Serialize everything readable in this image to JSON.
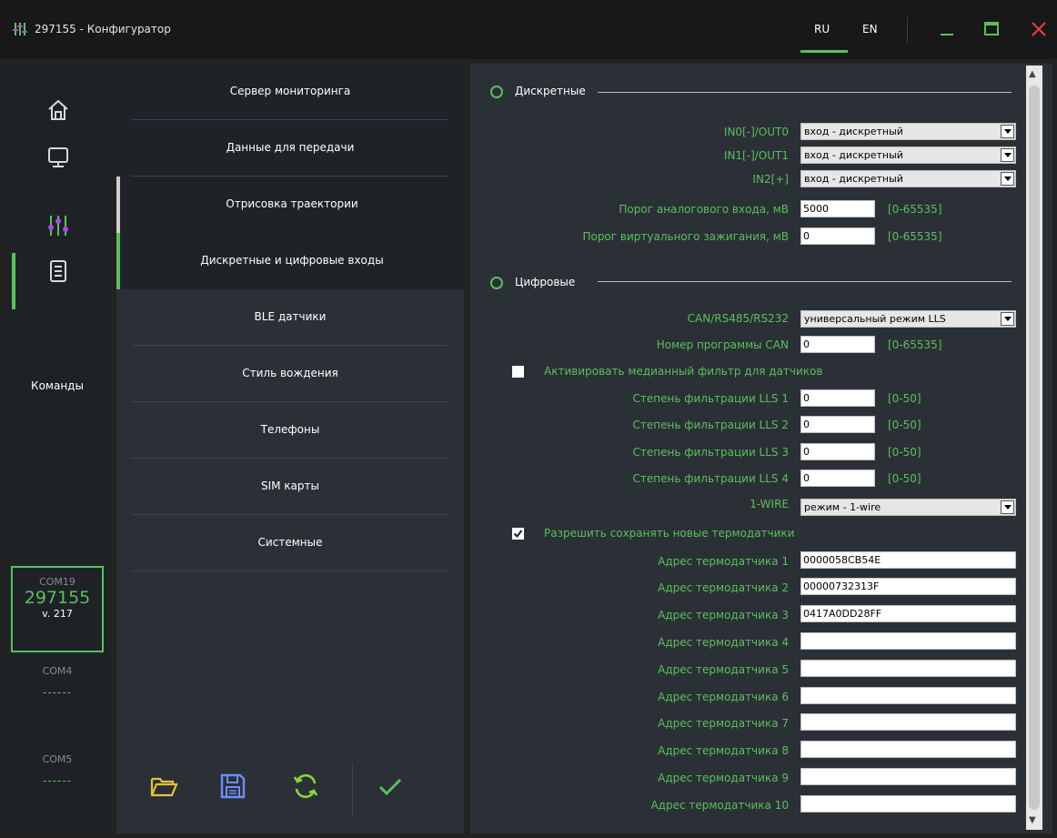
{
  "window": {
    "title": "297155 - Конфигуратор",
    "lang_ru": "RU",
    "lang_en": "EN",
    "accent": "#5cbf5c",
    "close_color": "#e04040"
  },
  "sidebar": {
    "commands_label": "Команды",
    "active_com": {
      "port": "COM19",
      "id": "297155",
      "version": "v. 217"
    },
    "other_coms": [
      {
        "port": "COM4",
        "dashes": "------"
      },
      {
        "port": "COM5",
        "dashes": "------"
      }
    ]
  },
  "menu": {
    "items": [
      "Сервер мониторинга",
      "Данные для передачи",
      "Отрисовка траектории",
      "Дискретные и цифровые входы",
      "BLE датчики",
      "Стиль вождения",
      "Телефоны",
      "SIM карты",
      "Системные"
    ],
    "selected_index": 3
  },
  "discrete": {
    "title": "Дискретные",
    "rows": [
      {
        "label": "IN0[-]/OUT0",
        "value": "вход - дискретный"
      },
      {
        "label": "IN1[-]/OUT1",
        "value": "вход - дискретный"
      },
      {
        "label": "IN2[+]",
        "value": "вход - дискретный"
      }
    ],
    "analog_label": "Порог аналогового входа, мВ",
    "analog_value": "5000",
    "analog_range": "[0-65535]",
    "ignition_label": "Порог виртуального зажигания, мВ",
    "ignition_value": "0",
    "ignition_range": "[0-65535]"
  },
  "digital": {
    "title": "Цифровые",
    "can_label": "CAN/RS485/RS232",
    "can_value": "универсальный режим LLS",
    "can_prog_label": "Номер программы CAN",
    "can_prog_value": "0",
    "can_prog_range": "[0-65535]",
    "median_label": "Активировать медианный фильтр для датчиков",
    "median_checked": false,
    "lls": [
      {
        "label": "Степень фильтрации LLS 1",
        "value": "0",
        "range": "[0-50]"
      },
      {
        "label": "Степень фильтрации LLS 2",
        "value": "0",
        "range": "[0-50]"
      },
      {
        "label": "Степень фильтрации LLS 3",
        "value": "0",
        "range": "[0-50]"
      },
      {
        "label": "Степень фильтрации LLS 4",
        "value": "0",
        "range": "[0-50]"
      }
    ],
    "onewire_label": "1-WIRE",
    "onewire_value": "режим - 1-wire",
    "save_label": "Разрешить сохранять новые термодатчики",
    "save_checked": true,
    "thermo": [
      {
        "label": "Адрес термодатчика 1",
        "value": "0000058CB54E"
      },
      {
        "label": "Адрес термодатчика 2",
        "value": "00000732313F"
      },
      {
        "label": "Адрес термодатчика 3",
        "value": "0417A0DD28FF"
      },
      {
        "label": "Адрес термодатчика 4",
        "value": ""
      },
      {
        "label": "Адрес термодатчика 5",
        "value": ""
      },
      {
        "label": "Адрес термодатчика 6",
        "value": ""
      },
      {
        "label": "Адрес термодатчика 7",
        "value": ""
      },
      {
        "label": "Адрес термодатчика 8",
        "value": ""
      },
      {
        "label": "Адрес термодатчика 9",
        "value": ""
      },
      {
        "label": "Адрес термодатчика 10",
        "value": ""
      }
    ]
  },
  "icons": [
    "app-icon",
    "home-icon",
    "monitor-icon",
    "sliders-icon",
    "document-icon",
    "folder-open-icon",
    "save-icon",
    "refresh-icon",
    "checkmark-icon",
    "minimize-icon",
    "maximize-icon",
    "close-icon"
  ]
}
